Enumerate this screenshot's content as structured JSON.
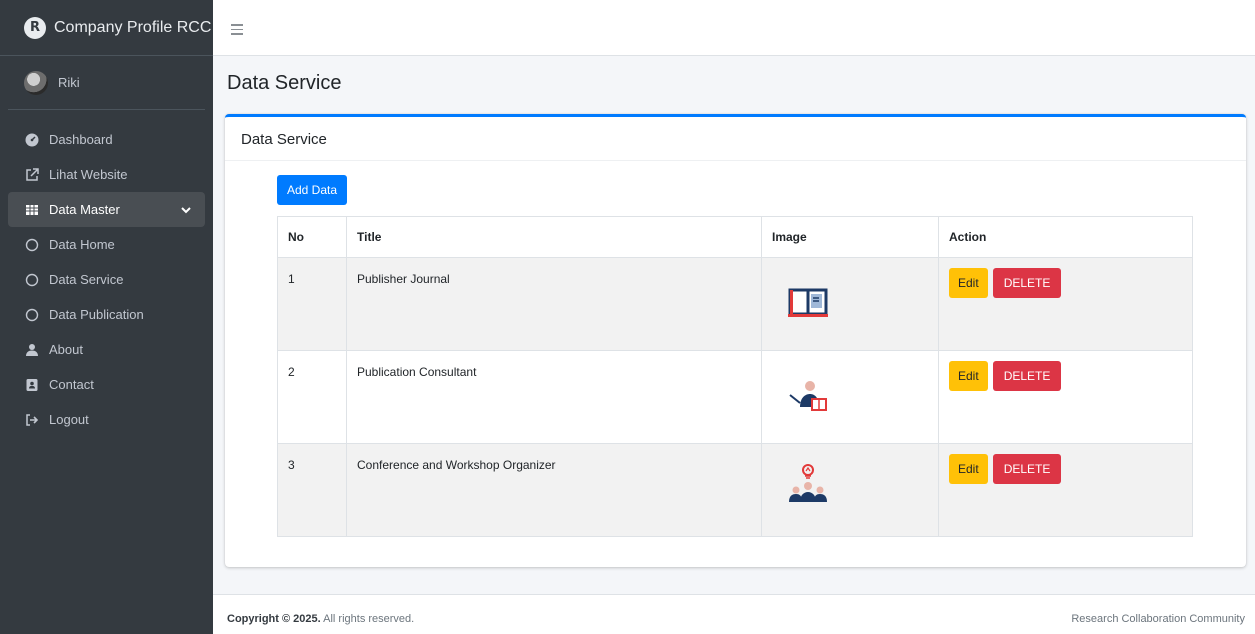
{
  "brand": {
    "name": "Company Profile RCC",
    "logo_icon": "rcc-logo-icon"
  },
  "user": {
    "name": "Riki"
  },
  "sidebar": {
    "items": [
      {
        "label": "Dashboard",
        "icon": "tachometer-icon"
      },
      {
        "label": "Lihat Website",
        "icon": "external-link-icon"
      },
      {
        "label": "Data Master",
        "icon": "table-icon",
        "active": true
      },
      {
        "label": "Data Home",
        "icon": "circle-outline-icon"
      },
      {
        "label": "Data Service",
        "icon": "circle-outline-icon"
      },
      {
        "label": "Data Publication",
        "icon": "circle-outline-icon"
      },
      {
        "label": "About",
        "icon": "user-icon"
      },
      {
        "label": "Contact",
        "icon": "address-card-icon"
      },
      {
        "label": "Logout",
        "icon": "sign-out-icon"
      }
    ]
  },
  "page": {
    "title": "Data Service"
  },
  "card": {
    "title": "Data Service",
    "add_button": "Add Data",
    "table": {
      "headers": [
        "No",
        "Title",
        "Image",
        "Action"
      ],
      "rows": [
        {
          "no": "1",
          "title": "Publisher Journal",
          "image_icon": "open-book-icon"
        },
        {
          "no": "2",
          "title": "Publication Consultant",
          "image_icon": "consultant-icon"
        },
        {
          "no": "3",
          "title": "Conference and Workshop Organizer",
          "image_icon": "conference-icon"
        }
      ],
      "edit_label": "Edit",
      "delete_label": "DELETE"
    }
  },
  "footer": {
    "copyright": "Copyright © 2025.",
    "rights": " All rights reserved.",
    "right_text": "Research Collaboration Community"
  },
  "colors": {
    "primary": "#007bff",
    "warning": "#ffc107",
    "danger": "#dc3545",
    "sidebar_bg": "#343a40"
  }
}
